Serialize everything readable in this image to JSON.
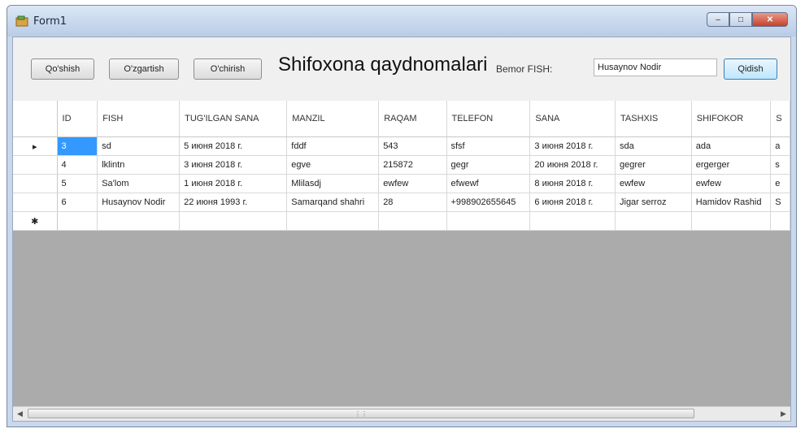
{
  "window": {
    "title": "Form1"
  },
  "toolbar": {
    "add_label": "Qo'shish",
    "edit_label": "O'zgartish",
    "delete_label": "O'chirish",
    "heading": "Shifoxona qaydnomalari",
    "patient_label": "Bemor FISH:",
    "search_value": "Husaynov Nodir",
    "search_label": "Qidish"
  },
  "table": {
    "columns": [
      "ID",
      "FISH",
      "TUG'ILGAN SANA",
      "MANZIL",
      "RAQAM",
      "TELEFON",
      "SANA",
      "TASHXIS",
      "SHIFOKOR",
      "S"
    ],
    "rows": [
      [
        "3",
        "sd",
        "5 июня 2018 г.",
        "fddf",
        "543",
        "sfsf",
        "3 июня 2018 г.",
        "sda",
        "ada",
        "a"
      ],
      [
        "4",
        "lklintn",
        "3 июня 2018 г.",
        "egve",
        "215872",
        "gegr",
        "20 июня 2018 г.",
        "gegrer",
        "ergerger",
        "s"
      ],
      [
        "5",
        "Sa'lom",
        "1 июня 2018 г.",
        "Mlilasdj",
        "ewfew",
        "efwewf",
        "8 июня 2018 г.",
        "ewfew",
        "ewfew",
        "e"
      ],
      [
        "6",
        "Husaynov Nodir",
        "22 июня 1993 г.",
        "Samarqand shahri",
        "28",
        "+998902655645",
        "6 июня 2018 г.",
        "Jigar serroz",
        "Hamidov Rashid",
        "S"
      ]
    ]
  }
}
